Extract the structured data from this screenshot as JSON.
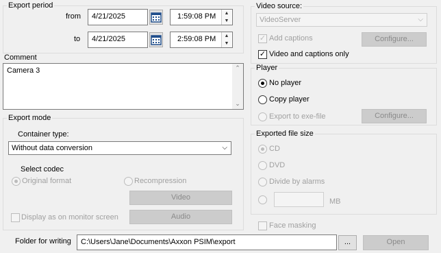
{
  "export_period": {
    "title": "Export period",
    "from_label": "from",
    "to_label": "to",
    "from_date": "4/21/2025",
    "from_time": "1:59:08 PM",
    "to_date": "4/21/2025",
    "to_time": "2:59:08 PM"
  },
  "comment": {
    "title": "Comment",
    "value": "Camera 3"
  },
  "export_mode": {
    "title": "Export mode",
    "container_label": "Container type:",
    "container_value": "Without data conversion",
    "select_codec_label": "Select codec",
    "original_format": "Original format",
    "recompression": "Recompression",
    "video_button": "Video",
    "audio_button": "Audio",
    "display_monitor": "Display as on monitor screen"
  },
  "video_source": {
    "title": "Video source:",
    "value": "VideoServer",
    "add_captions": "Add captions",
    "configure": "Configure...",
    "video_and_captions": "Video and captions only"
  },
  "player": {
    "title": "Player",
    "no_player": "No player",
    "copy_player": "Copy player",
    "export_exe": "Export to exe-file",
    "configure": "Configure..."
  },
  "file_size": {
    "title": "Exported file size",
    "cd": "CD",
    "dvd": "DVD",
    "divide_alarms": "Divide by alarms",
    "custom_value": "",
    "unit": "MB"
  },
  "face_masking": "Face masking",
  "folder": {
    "label": "Folder for writing",
    "path": "C:\\Users\\Jane\\Documents\\Axxon PSIM\\export",
    "browse": "...",
    "open": "Open"
  }
}
